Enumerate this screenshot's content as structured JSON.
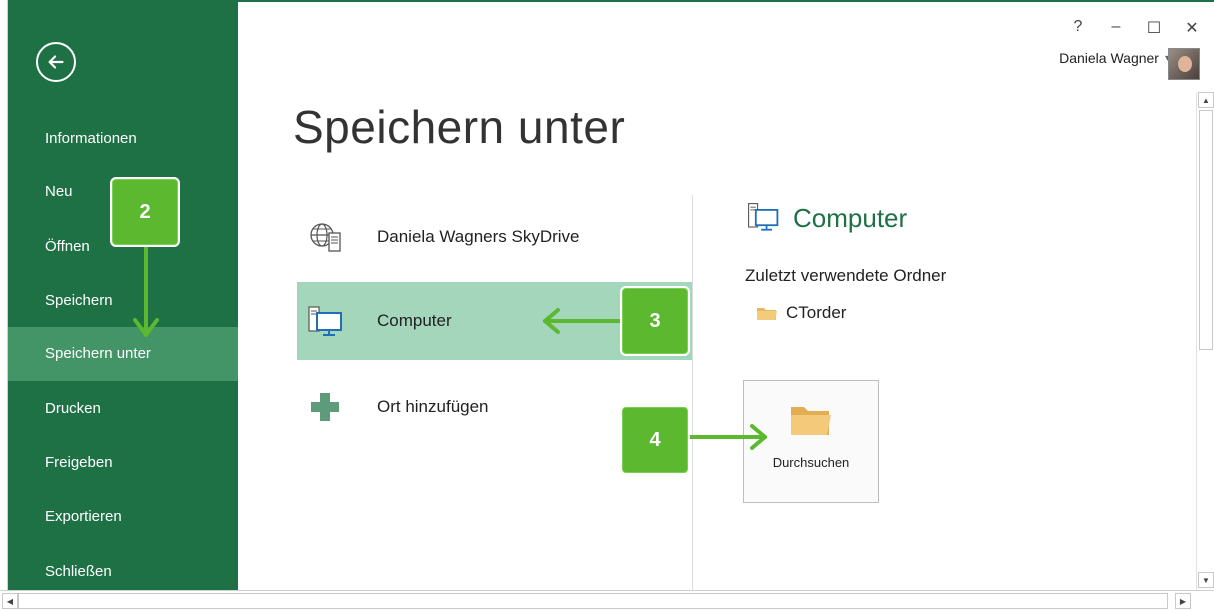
{
  "window": {
    "help": "?",
    "minimize": "–",
    "maximize": "☐",
    "close": "✕"
  },
  "user": {
    "name": "Daniela Wagner",
    "dropdown": "▾"
  },
  "sidebar": {
    "items": [
      {
        "label": "Informationen"
      },
      {
        "label": "Neu"
      },
      {
        "label": "Öffnen"
      },
      {
        "label": "Speichern"
      },
      {
        "label": "Speichern unter"
      },
      {
        "label": "Drucken"
      },
      {
        "label": "Freigeben"
      },
      {
        "label": "Exportieren"
      },
      {
        "label": "Schließen"
      }
    ],
    "selected": "Speichern unter"
  },
  "page": {
    "title": "Speichern unter"
  },
  "places": [
    {
      "label": "Daniela Wagners SkyDrive",
      "icon": "globe-server-icon"
    },
    {
      "label": "Computer",
      "icon": "computer-icon"
    },
    {
      "label": "Ort hinzufügen",
      "icon": "plus-icon"
    }
  ],
  "right_panel": {
    "heading": "Computer",
    "recent_label": "Zuletzt verwendete Ordner",
    "recent_folders": [
      {
        "name": "CTorder"
      }
    ],
    "browse_label": "Durchsuchen"
  },
  "callouts": [
    {
      "number": "2"
    },
    {
      "number": "3"
    },
    {
      "number": "4"
    }
  ],
  "colors": {
    "sidebar": "#1e7145",
    "sidebar_selected": "#439467",
    "place_selected": "#a3d6ba",
    "callout": "#5cb82e"
  },
  "scrollbars": {
    "up": "▲",
    "down": "▼",
    "left": "◀",
    "right": "▶"
  }
}
